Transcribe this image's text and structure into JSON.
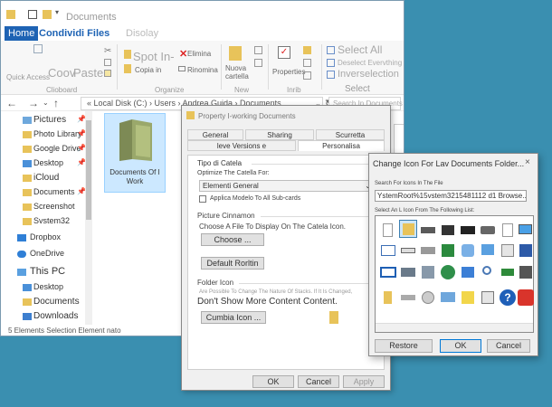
{
  "explorer": {
    "title": "Documents",
    "tabs": {
      "home": "Home",
      "share": "Condividi Files",
      "view": "Disolay"
    },
    "ribbon": {
      "quick_access": "Quick Access",
      "copy": "Coov",
      "paste": "Paste",
      "clipboard_group": "Clioboard",
      "spot_in": "Spot In-",
      "copy_in": "Copia in",
      "elimina": "Elimina",
      "rinomina": "Rinomina",
      "organize_group": "Organize",
      "new_folder_line1": "Nuova",
      "new_folder_line2": "cartella",
      "new_group": "New",
      "properties": "Properties",
      "open_group": "Inrib",
      "select_all": "Select All",
      "deselect": "Deselect Evervthing",
      "invert": "Inverselection",
      "select_group": "Select"
    },
    "address": "« Local Disk (C:) › Users › Andrea Guida › Documents",
    "search_placeholder": "Search In Documents",
    "nav_items": [
      "Pictures",
      "Photo Library",
      "Google Drive",
      "Desktop",
      "iCloud",
      "Documents",
      "Screenshot",
      "Svstem32",
      "Dropbox",
      "OneDrive",
      "This PC",
      "Desktop",
      "Documents",
      "Downloads"
    ],
    "folder_label": "Documents Of I Work",
    "status": "5 Elements    Selection Element nato"
  },
  "properties": {
    "title": "Property I-working Documents",
    "tabs": {
      "general": "General",
      "sharing": "Sharing",
      "security": "Scurretta",
      "previous": "leve Versions e",
      "customize": "Personalisa"
    },
    "type_section": "Tipo di Catela",
    "optimize_label": "Optimize The Catella For:",
    "optimize_value": "Elementi General",
    "apply_template": "Applica Modelo To All Sub-cards",
    "picture_section": "Picture Cinnamon",
    "choose_file_text": "Choose A File To Display On The Catela Icon.",
    "choose_button": "Choose ...",
    "default_button": "Default Rorltin",
    "folder_icon_section": "Folder Icon",
    "folder_icon_desc": "Are Possible To Change The Nature Of Stacks. If It Is Changed,",
    "no_preview": "Don't Show More Content Content.",
    "change_icon_button": "Cumbia Icon ...",
    "ok": "OK",
    "cancel": "Cancel",
    "apply": "Apply"
  },
  "change_icon": {
    "title": "Change Icon For Lav Documents Folder...",
    "close": "×",
    "file_label": "Search For Icons In The File",
    "file_path": "YstemRoot%15vstem3215481112 d1 Browse...",
    "browse": "...",
    "list_label": "Select An L Icon From The Following List:",
    "restore": "Restore",
    "ok": "OK",
    "cancel": "Cancel"
  }
}
